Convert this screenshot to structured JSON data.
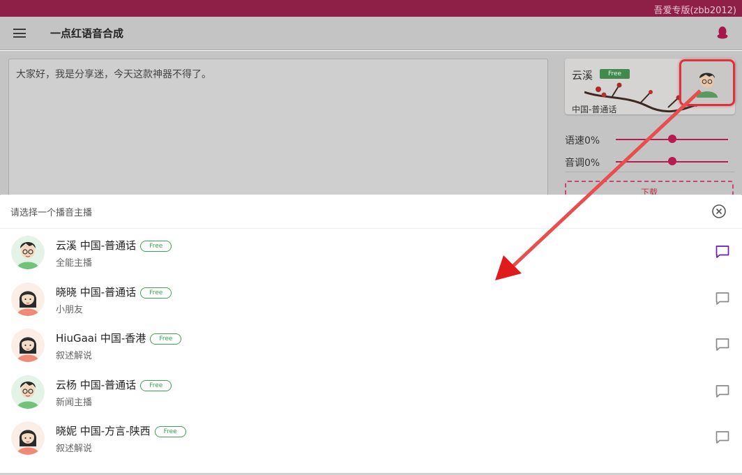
{
  "watermark": "吾爱专版(zbb2012)",
  "app": {
    "title": "一点红语音合成"
  },
  "editor": {
    "text": "大家好，我是分享迷，今天这款神器不得了。"
  },
  "current_voice": {
    "name": "云溪",
    "badge": "Free",
    "lang": "中国-普通话"
  },
  "sliders": [
    {
      "label": "语速0%",
      "level_pct": 50
    },
    {
      "label": "音调0%",
      "level_pct": 50
    }
  ],
  "action_button": {
    "label": "下载"
  },
  "sheet": {
    "title": "请选择一个播音主播",
    "voices": [
      {
        "name": "云溪 中国-普通话",
        "badge": "Free",
        "desc": "全能主播",
        "gender": "male",
        "selected": true
      },
      {
        "name": "晓晓 中国-普通话",
        "badge": "Free",
        "desc": "小朋友",
        "gender": "female",
        "selected": false
      },
      {
        "name": "HiuGaai 中国-香港",
        "badge": "Free",
        "desc": "叙述解说",
        "gender": "female",
        "selected": false
      },
      {
        "name": "云杨 中国-普通话",
        "badge": "Free",
        "desc": "新闻主播",
        "gender": "male",
        "selected": false
      },
      {
        "name": "晓妮 中国-方言-陕西",
        "badge": "Free",
        "desc": "叙述解说",
        "gender": "female",
        "selected": false
      }
    ]
  },
  "icons": {
    "menu": "hamburger-menu-icon",
    "qq": "qq-penguin-icon",
    "close": "close-circle-icon",
    "chat": "chat-bubble-icon"
  },
  "colors": {
    "brand": "#b71b51",
    "selected_icon": "#6a1bb7",
    "free_badge": "#3fa152",
    "annotation_arrow": "#e01b1b"
  }
}
